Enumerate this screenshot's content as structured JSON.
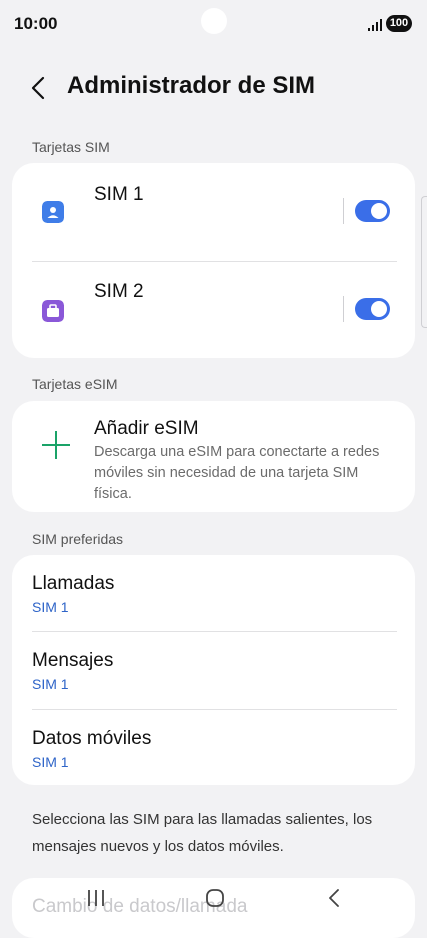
{
  "status_bar": {
    "time": "10:00",
    "battery": "100"
  },
  "header": {
    "title": "Administrador de SIM"
  },
  "sections": {
    "sim_cards": "Tarjetas SIM",
    "esim_cards": "Tarjetas eSIM",
    "preferred": "SIM preferidas"
  },
  "sim_cards": [
    {
      "label": "SIM 1",
      "enabled": true,
      "color": "#3f7de8",
      "icon": "sim-contact-icon"
    },
    {
      "label": "SIM 2",
      "enabled": true,
      "color": "#8a58d8",
      "icon": "sim-briefcase-icon"
    }
  ],
  "esim": {
    "title": "Añadir eSIM",
    "description": "Descarga una eSIM para conectarte a redes móviles sin necesidad de una tarjeta SIM física.",
    "icon": "plus-icon",
    "accent": "#1aa368"
  },
  "preferred": [
    {
      "title": "Llamadas",
      "value": "SIM 1"
    },
    {
      "title": "Mensajes",
      "value": "SIM 1"
    },
    {
      "title": "Datos móviles",
      "value": "SIM 1"
    }
  ],
  "footnote": "Selecciona las SIM para las llamadas salientes, los mensajes nuevos y los datos móviles.",
  "bottom_item": {
    "title": "Cambio de datos/llamada"
  },
  "colors": {
    "toggle_on": "#3a6ee8",
    "link_blue": "#2e64c8",
    "background": "#f2f2f4"
  }
}
